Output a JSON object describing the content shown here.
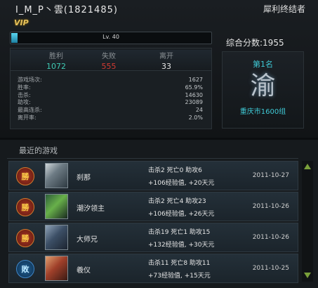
{
  "player": {
    "name": "I_M_P丶雲(1821485)",
    "title": "犀利终结者",
    "vip": "VIP"
  },
  "level": {
    "label": "Lv. 40",
    "progress": 0.03
  },
  "score": "综合分数:1955",
  "summary": {
    "win_label": "胜利",
    "win_value": "1072",
    "loss_label": "失败",
    "loss_value": "555",
    "leave_label": "离开",
    "leave_value": "33"
  },
  "stats": [
    {
      "label": "游戏场次:",
      "value": "1627"
    },
    {
      "label": "胜率:",
      "value": "65.9%"
    },
    {
      "label": "击杀:",
      "value": "14630"
    },
    {
      "label": "助攻:",
      "value": "23089"
    },
    {
      "label": "最高连杀:",
      "value": "24"
    },
    {
      "label": "离开率:",
      "value": "2.0%"
    }
  ],
  "rank": {
    "title": "第1名",
    "glyph": "渝",
    "group": "重庆市1600组"
  },
  "recent": {
    "title": "最近的游戏",
    "games": [
      {
        "result": "勝",
        "hero": "刹那",
        "kda": "击杀2  死亡0  助攻6",
        "reward": "+106经验值, +20天元",
        "date": "2011-10-27"
      },
      {
        "result": "勝",
        "hero": "潮汐领主",
        "kda": "击杀2  死亡4  助攻23",
        "reward": "+106经验值, +26天元",
        "date": "2011-10-26"
      },
      {
        "result": "勝",
        "hero": "大师兄",
        "kda": "击杀19  死亡1  助攻15",
        "reward": "+132经验值, +30天元",
        "date": "2011-10-26"
      },
      {
        "result": "敗",
        "hero": "羲仪",
        "kda": "击杀11  死亡8  助攻11",
        "reward": "+73经验值, +15天元",
        "date": "2011-10-25"
      }
    ]
  },
  "colors": {
    "win": "#3fc9b3",
    "loss": "#d23a32",
    "accent": "#3fc9d6",
    "vip": "#e6c15a"
  }
}
